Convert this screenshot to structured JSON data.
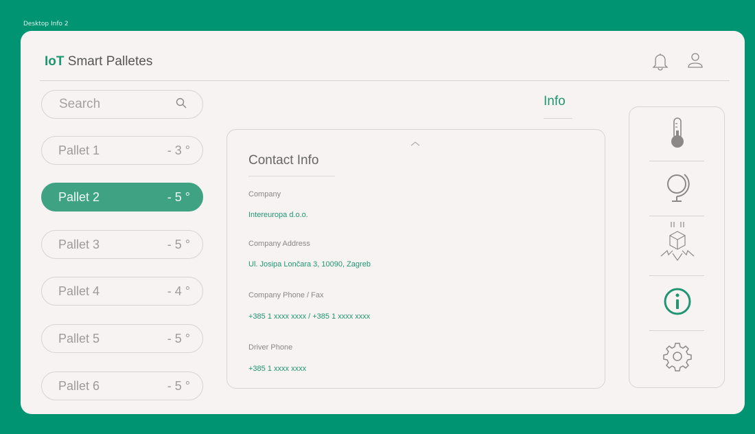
{
  "frame_label": "Desktop Info 2",
  "app": {
    "brand": "IoT",
    "title": " Smart Palletes"
  },
  "icons": {
    "notifications": "bell-icon",
    "user": "user-icon",
    "search": "search-icon"
  },
  "search": {
    "placeholder": "Search"
  },
  "pallets": [
    {
      "name": "Pallet 1",
      "temp": "- 3 °"
    },
    {
      "name": "Pallet 2",
      "temp": "- 5 °",
      "active": true
    },
    {
      "name": "Pallet 3",
      "temp": "- 5 °"
    },
    {
      "name": "Pallet 4",
      "temp": "- 4 °"
    },
    {
      "name": "Pallet 5",
      "temp": "- 5 °"
    },
    {
      "name": "Pallet 6",
      "temp": "- 5 °"
    }
  ],
  "section_title": "Info",
  "contact": {
    "title": "Contact Info",
    "company_label": "Company",
    "company_value": "Intereuropa d.o.o.",
    "address_label": "Company Address",
    "address_value": "Ul. Josipa Lončara 3, 10090, Zagreb",
    "phone_label": "Company Phone / Fax",
    "phone_value": "+385 1 xxxx xxxx / +385 1 xxxx xxxx",
    "driver_label": "Driver Phone",
    "driver_value": "+385 1 xxxx xxxx"
  },
  "right_nav": [
    "thermometer-icon",
    "globe-icon",
    "fragile-box-icon",
    "info-icon",
    "settings-icon"
  ],
  "colors": {
    "brand": "#1f9572",
    "background": "#009472",
    "active": "#3fa383",
    "surface": "#f6f3f2"
  }
}
